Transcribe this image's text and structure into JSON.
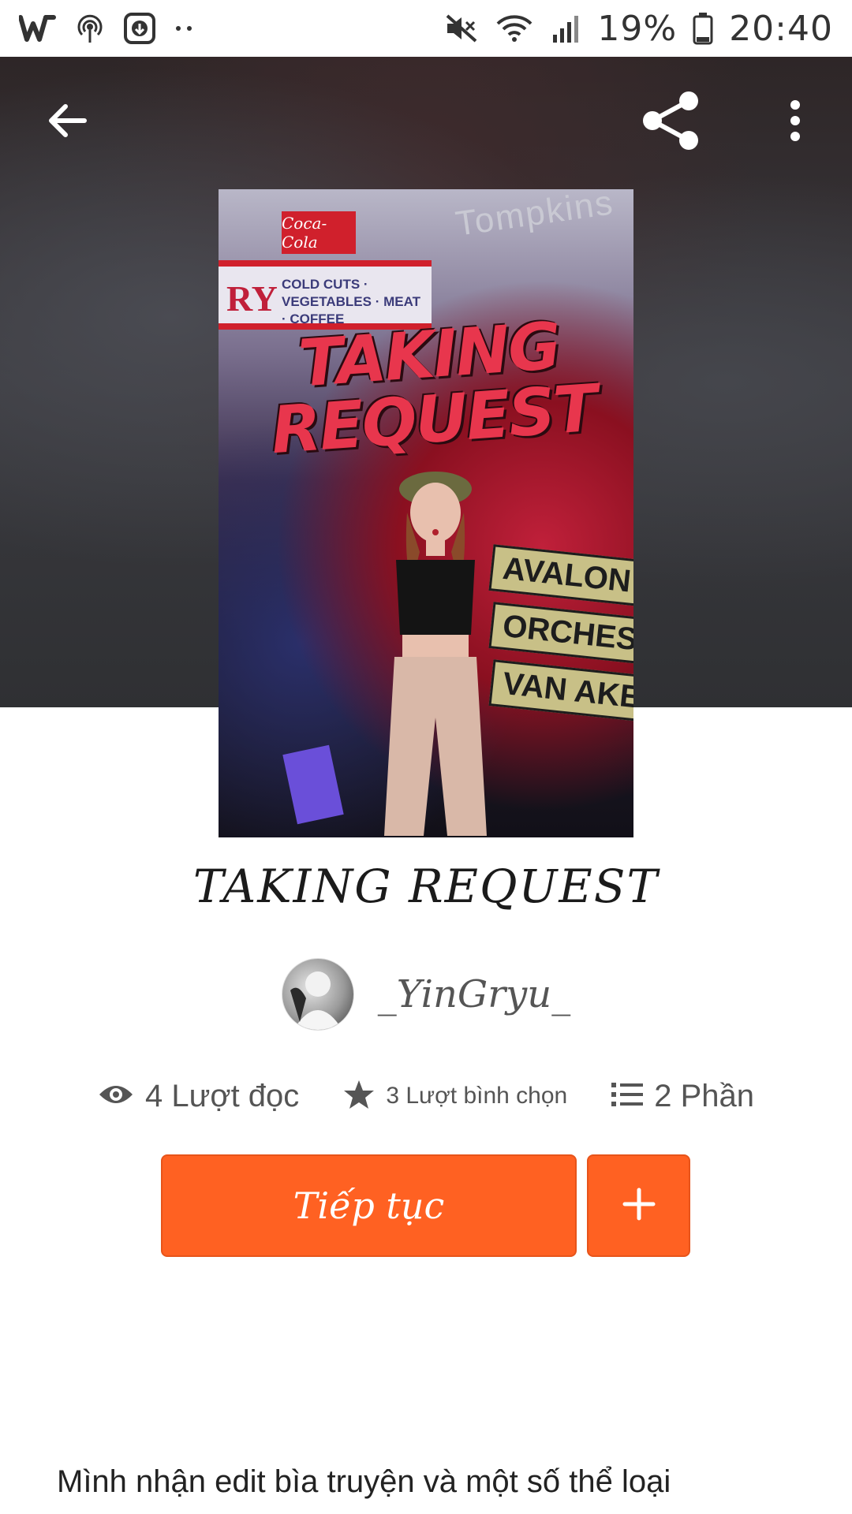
{
  "status_bar": {
    "battery_percent": "19%",
    "time": "20:40",
    "left_icons": [
      "wattpad-icon",
      "hotspot-icon",
      "download-icon",
      "more-dots-icon"
    ],
    "right_icons": [
      "mute-icon",
      "wifi-icon",
      "signal-icon",
      "battery-icon"
    ]
  },
  "header": {
    "back_icon": "arrow-left-icon",
    "share_icon": "share-icon",
    "more_icon": "more-vertical-icon"
  },
  "cover": {
    "title": "TAKING REQUEST",
    "coke_sign": "Coca-Cola",
    "store_sign": "COLD CUTS · VEGETABLES · MEAT · COFFEE",
    "store_letters": "RY",
    "building_sign": "Tompkins",
    "street_signs": [
      "AVALON",
      "ORCHESTRA",
      "VAN AKEN"
    ]
  },
  "story": {
    "title": "TAKING REQUEST",
    "author": "_YinGryu_",
    "reads": "4 Lượt đọc",
    "votes": "3 Lượt bình chọn",
    "parts": "2 Phần",
    "continue_label": "Tiếp tục",
    "add_label": "+",
    "description": "Mình nhận edit bìa truyện và một số thể loại"
  },
  "colors": {
    "accent": "#ff6122",
    "text": "#222222",
    "muted": "#555555"
  }
}
